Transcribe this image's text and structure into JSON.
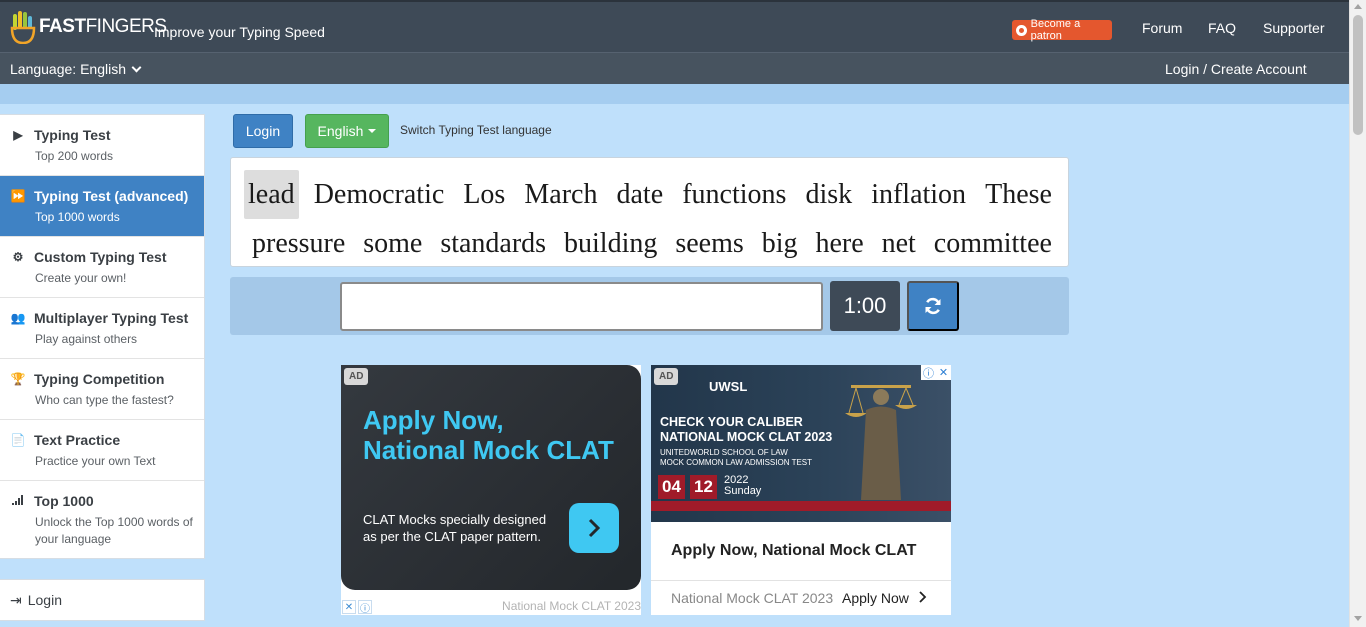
{
  "header": {
    "logo_text_bold": "FAST",
    "logo_text_thin": "FINGERS",
    "tagline": "Improve your Typing Speed",
    "patron_label": "Become a patron",
    "nav": [
      "Forum",
      "FAQ",
      "Supporter"
    ],
    "language_label": "Language: English",
    "login_create": "Login / Create Account"
  },
  "sidebar": {
    "items": [
      {
        "title": "Typing Test",
        "subtitle": "Top 200 words"
      },
      {
        "title": "Typing Test (advanced)",
        "subtitle": "Top 1000 words"
      },
      {
        "title": "Custom Typing Test",
        "subtitle": "Create your own!"
      },
      {
        "title": "Multiplayer Typing Test",
        "subtitle": "Play against others"
      },
      {
        "title": "Typing Competition",
        "subtitle": "Who can type the fastest?"
      },
      {
        "title": "Text Practice",
        "subtitle": "Practice your own Text"
      },
      {
        "title": "Top 1000",
        "subtitle": "Unlock the Top 1000 words of your language"
      }
    ],
    "login_label": "Login"
  },
  "toolbar": {
    "login_button": "Login",
    "language_button": "English",
    "switch_text": "Switch Typing Test language"
  },
  "words": {
    "line1": [
      "lead",
      "Democratic",
      "Los",
      "March",
      "date",
      "functions",
      "disk",
      "inflation",
      "These"
    ],
    "line2": [
      "pressure",
      "some",
      "standards",
      "building",
      "seems",
      "big",
      "here",
      "net",
      "committee"
    ]
  },
  "typing": {
    "input_value": "",
    "timer": "1:00"
  },
  "ad1": {
    "badge": "AD",
    "headline_1": "Apply Now,",
    "headline_2": "National Mock CLAT",
    "desc": "CLAT Mocks specially designed as per the CLAT paper pattern.",
    "footer": "National Mock CLAT 2023"
  },
  "ad2": {
    "badge": "AD",
    "brand": "UWSL",
    "check_1": "CHECK YOUR CALIBER",
    "check_2": "NATIONAL MOCK CLAT 2023",
    "school_1": "UNITEDWORLD SCHOOL OF LAW",
    "school_2": "MOCK COMMON LAW ADMISSION TEST",
    "date_1": "04",
    "date_2": "12",
    "year": "2022",
    "weekday": "Sunday",
    "title": "Apply Now, National Mock CLAT",
    "source": "National Mock CLAT 2023",
    "cta": "Apply Now"
  }
}
